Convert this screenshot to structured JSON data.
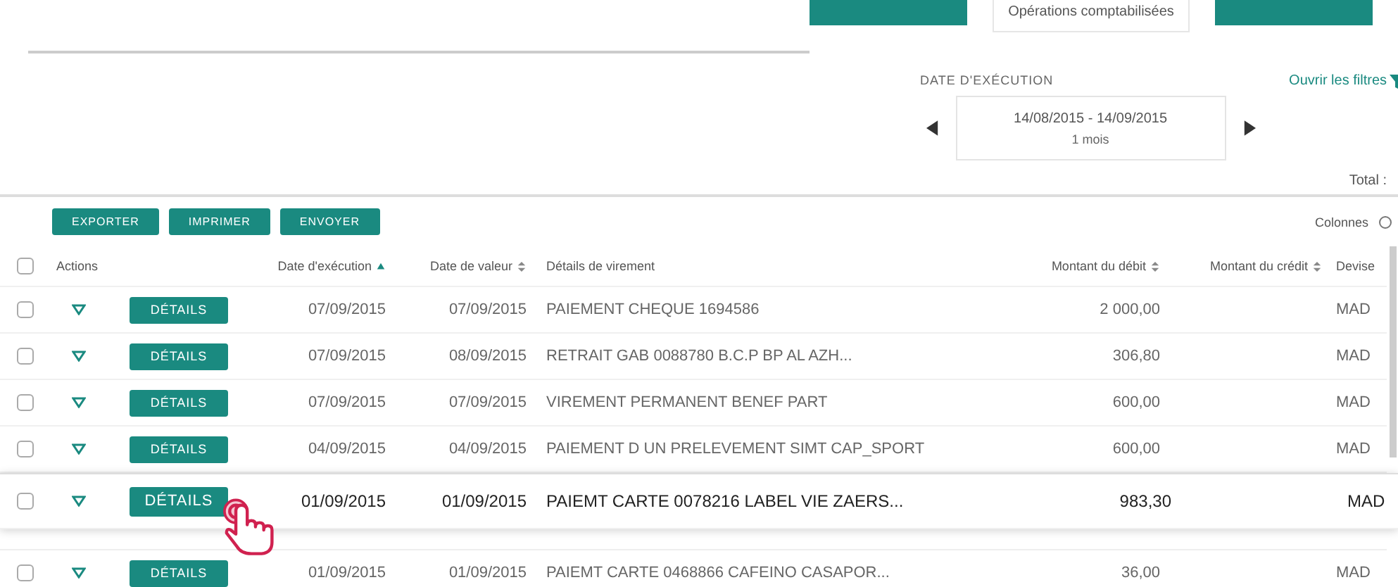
{
  "tabs": [
    {
      "selected": false
    },
    {
      "label": "Opérations comptabilisées",
      "selected": true
    },
    {
      "selected": false
    }
  ],
  "filter": {
    "label": "DATE D'EXÉCUTION",
    "range": "14/08/2015 - 14/09/2015",
    "period": "1 mois",
    "open_filters": "Ouvrir les filtres"
  },
  "total": "Total :",
  "toolbar": {
    "buttons": [
      "EXPORTER",
      "IMPRIMER",
      "ENVOYER"
    ],
    "columns_label": "Colonnes"
  },
  "table": {
    "header_checked": false,
    "columns": [
      {
        "label": "Actions",
        "kind": "plain"
      },
      {
        "label": "Date d'exécution",
        "kind": "sorted"
      },
      {
        "label": "Date de valeur",
        "kind": "sortable"
      },
      {
        "label": "Détails de virement",
        "kind": "plain"
      },
      {
        "label": "Montant du débit",
        "kind": "sortable"
      },
      {
        "label": "Montant du crédit",
        "kind": "sortable"
      },
      {
        "label": "Devise",
        "kind": "plain"
      }
    ],
    "rows": [
      {
        "checked": false,
        "selected": false,
        "action": "DÉTAILS",
        "exec": "07/09/2015",
        "value": "07/09/2015",
        "details": "PAIEMENT CHEQUE 1694586",
        "debit": "2 000,00",
        "currency": "MAD"
      },
      {
        "checked": false,
        "selected": false,
        "action": "DÉTAILS",
        "exec": "07/09/2015",
        "value": "08/09/2015",
        "details": "RETRAIT GAB 0088780 B.C.P BP AL AZH...",
        "debit": "306,80",
        "currency": "MAD"
      },
      {
        "checked": false,
        "selected": false,
        "action": "DÉTAILS",
        "exec": "07/09/2015",
        "value": "07/09/2015",
        "details": "VIREMENT PERMANENT BENEF PART",
        "debit": "600,00",
        "currency": "MAD"
      },
      {
        "checked": false,
        "selected": false,
        "action": "DÉTAILS",
        "exec": "04/09/2015",
        "value": "04/09/2015",
        "details": "PAIEMENT D UN PRELEVEMENT SIMT CAP_SPORT",
        "debit": "600,00",
        "currency": "MAD"
      },
      {
        "checked": false,
        "selected": true,
        "action": "DÉTAILS",
        "exec": "01/09/2015",
        "value": "01/09/2015",
        "details": "PAIEMT CARTE 0078216 LABEL VIE ZAERS...",
        "debit": "983,30",
        "currency": "MAD"
      },
      {
        "checked": false,
        "selected": false,
        "action": "DÉTAILS",
        "exec": "01/09/2015",
        "value": "01/09/2015",
        "details": "PAIEMT CARTE 0468866 CAFEINO CASAPOR...",
        "debit": "36,00",
        "currency": "MAD"
      }
    ]
  }
}
